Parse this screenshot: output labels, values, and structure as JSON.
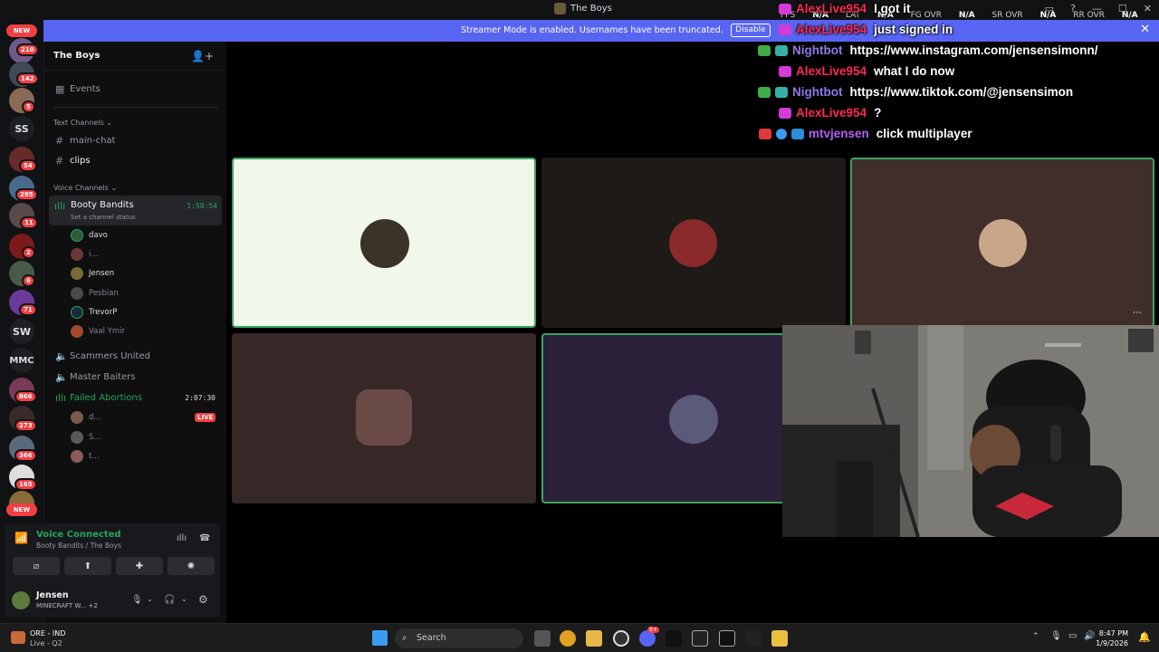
{
  "window": {
    "title": "The Boys"
  },
  "stats": [
    {
      "label": "FPS",
      "value": "N/A"
    },
    {
      "label": "LAT",
      "value": "N/A"
    },
    {
      "label": "FG OVR",
      "value": "N/A"
    },
    {
      "label": "SR OVR",
      "value": "N/A"
    },
    {
      "label": "RR OVR",
      "value": "N/A"
    }
  ],
  "banner": {
    "text": "Streamer Mode is enabled. Usernames have been truncated.",
    "button": "Disable"
  },
  "rail": {
    "new_top": "NEW",
    "new_bottom": "NEW",
    "badges": [
      "210",
      "142",
      "5",
      "54",
      "295",
      "11",
      "2",
      "6",
      "71",
      "866",
      "273",
      "366",
      "165"
    ],
    "text_servers": [
      "SS",
      "SW",
      "MMC"
    ]
  },
  "guild": {
    "name": "The Boys",
    "events": "Events"
  },
  "text_channels": {
    "category": "Text Channels",
    "items": [
      "main-chat",
      "clips"
    ]
  },
  "voice_channels": {
    "category": "Voice Channels",
    "active": {
      "name": "Booty Bandits",
      "timer": "1:58:54",
      "status": "Set a channel status"
    },
    "members": [
      "davo",
      "i...",
      "Jensen",
      "Pesbian",
      "TrevorP",
      "Vaal Ymir"
    ],
    "others": [
      "Scammers United",
      "Master Baiters"
    ],
    "failed": {
      "name": "Failed Abortions",
      "timer": "2:07:30",
      "members": [
        "d...",
        "S...",
        "t..."
      ],
      "live": "LIVE"
    }
  },
  "voice_panel": {
    "title": "Voice Connected",
    "subtitle": "Booty Bandits / The Boys"
  },
  "user": {
    "name": "Jensen",
    "status": "MINECRAFT W...",
    "extra": "+2"
  },
  "chat": [
    {
      "user": "AlexLive954",
      "text": "I got it",
      "color": "#ff2a55"
    },
    {
      "user": "AlexLive954",
      "text": "just signed in",
      "color": "#ff2a55"
    },
    {
      "user": "Nightbot",
      "text": "https://www.instagram.com/jensensimonn/",
      "color": "#8c7be8"
    },
    {
      "user": "AlexLive954",
      "text": "what I do now",
      "color": "#ff2a55"
    },
    {
      "user": "Nightbot",
      "text": "https://www.tiktok.com/@jensensimon",
      "color": "#8c7be8"
    },
    {
      "user": "AlexLive954",
      "text": "?",
      "color": "#ff2a55"
    },
    {
      "user": "mtvjensen",
      "text": "click multiplayer",
      "color": "#b45ef0"
    }
  ],
  "taskbar": {
    "weather": {
      "line1": "ORE - IND",
      "line2": "Live - Q2"
    },
    "search": "Search",
    "time": "8:47 PM",
    "date": "1/9/2026",
    "discord_badge": "9+"
  },
  "colors": {
    "accent": "#5865f2",
    "online": "#23a55a",
    "live": "#f23f43"
  }
}
